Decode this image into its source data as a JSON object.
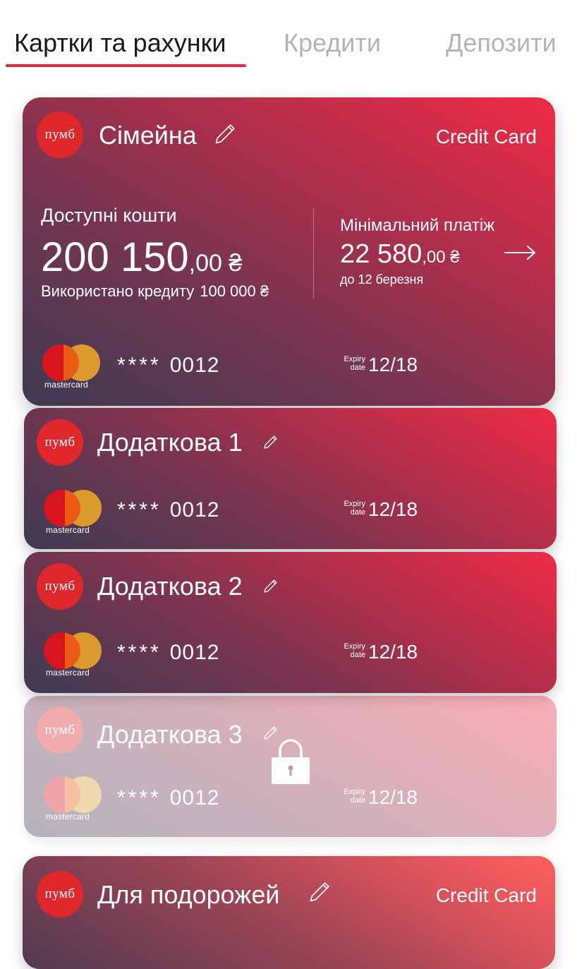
{
  "tabs": [
    {
      "label": "Картки та рахунки",
      "active": true
    },
    {
      "label": "Кредити",
      "active": false
    },
    {
      "label": "Депозити",
      "active": false
    }
  ],
  "bank_logo_text": "пумб",
  "brand_colors": {
    "accent": "#e8263f",
    "logo_red": "#e0272c"
  },
  "cards": [
    {
      "name": "Сімейна",
      "type": "Credit Card",
      "available_label": "Доступні кошти",
      "available_int": "200 150",
      "available_dec": ",00 ₴",
      "credit_used_label": "Використано кредиту",
      "credit_used_amount": "100 000 ₴",
      "min_payment_label": "Мінімальний платіж",
      "min_payment_int": "22 580",
      "min_payment_dec": ",00 ₴",
      "min_payment_due": "до 12 березня",
      "payment_system": "mastercard",
      "number_mask": "****",
      "number_last4": "0012",
      "expiry_label_1": "Expiry",
      "expiry_label_2": "date",
      "expiry": "12/18",
      "locked": false
    },
    {
      "name": "Додаткова 1",
      "payment_system": "mastercard",
      "number_mask": "****",
      "number_last4": "0012",
      "expiry_label_1": "Expiry",
      "expiry_label_2": "date",
      "expiry": "12/18",
      "locked": false
    },
    {
      "name": "Додаткова 2",
      "payment_system": "mastercard",
      "number_mask": "****",
      "number_last4": "0012",
      "expiry_label_1": "Expiry",
      "expiry_label_2": "date",
      "expiry": "12/18",
      "locked": false
    },
    {
      "name": "Додаткова 3",
      "payment_system": "mastercard",
      "number_mask": "****",
      "number_last4": "0012",
      "expiry_label_1": "Expiry",
      "expiry_label_2": "date",
      "expiry": "12/18",
      "locked": true
    },
    {
      "name": "Для подорожей",
      "type": "Credit Card",
      "locked": false
    }
  ],
  "icons": {
    "edit": "pencil-icon",
    "arrow": "arrow-right-icon",
    "lock": "lock-icon"
  }
}
